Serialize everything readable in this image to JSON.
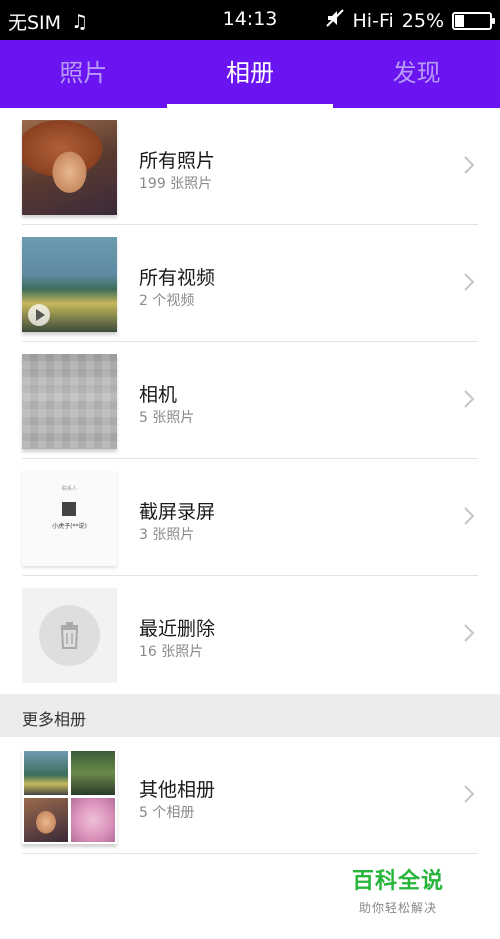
{
  "status_bar": {
    "carrier": "无SIM",
    "time": "14:13",
    "network": "Hi-Fi",
    "battery_percent_label": "25%",
    "battery_level": 0.25
  },
  "tabs": [
    {
      "label": "照片",
      "active": false
    },
    {
      "label": "相册",
      "active": true
    },
    {
      "label": "发现",
      "active": false
    }
  ],
  "albums": [
    {
      "title": "所有照片",
      "count": "199 张照片"
    },
    {
      "title": "所有视频",
      "count": "2 个视频"
    },
    {
      "title": "相机",
      "count": "5 张照片"
    },
    {
      "title": "截屏录屏",
      "count": "3 张照片"
    },
    {
      "title": "最近删除",
      "count": "16 张照片"
    }
  ],
  "screenshot_thumb": {
    "top_text": "联系人",
    "name": "小虎子(**说)"
  },
  "more_albums": {
    "header": "更多相册",
    "items": [
      {
        "title": "其他相册",
        "count": "5 个相册"
      }
    ]
  },
  "watermark": {
    "title": "百科全说",
    "subtitle": "助你轻松解决"
  },
  "colors": {
    "tab_bar": "#6a14f2",
    "tab_active": "#ffffff",
    "tab_inactive": "#b79af8",
    "watermark_green": "#27b53a"
  }
}
